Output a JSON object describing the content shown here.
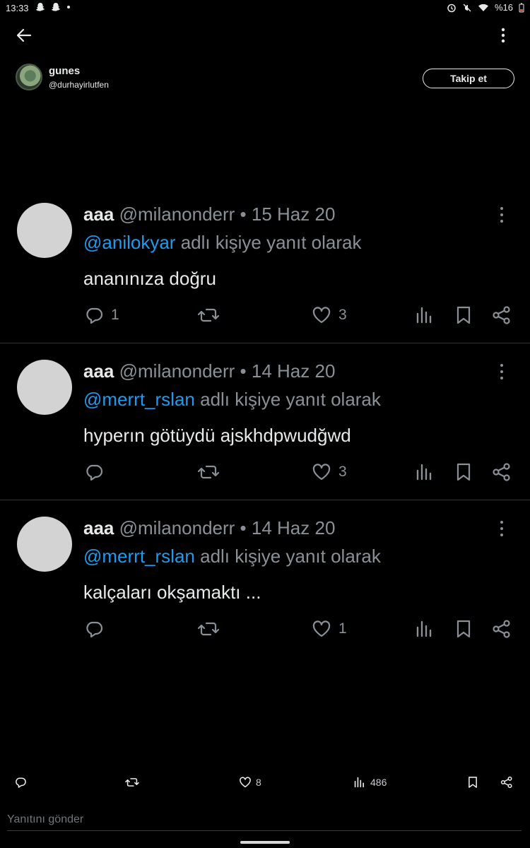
{
  "status_bar": {
    "time": "13:33",
    "battery": "%16"
  },
  "author": {
    "name": "gunes",
    "handle": "@durhayirlutfen",
    "follow_label": "Takip et"
  },
  "replies": [
    {
      "name": "aaa",
      "handle": "@milanonderr",
      "sep": "•",
      "date": "15 Haz 20",
      "mention": "@anilokyar",
      "reply_suffix": "adlı kişiye yanıt olarak",
      "text": "ananınıza doğru",
      "reply_count": "1",
      "like_count": "3"
    },
    {
      "name": "aaa",
      "handle": "@milanonderr",
      "sep": "•",
      "date": "14 Haz 20",
      "mention": "@merrt_rslan",
      "reply_suffix": "adlı kişiye yanıt olarak",
      "text": "hyperın götüydü ajskhdpwudğwd",
      "reply_count": "",
      "like_count": "3"
    },
    {
      "name": "aaa",
      "handle": "@milanonderr",
      "sep": "•",
      "date": "14 Haz 20",
      "mention": "@merrt_rslan",
      "reply_suffix": "adlı kişiye yanıt olarak",
      "text": "kalçaları okşamaktı ...",
      "reply_count": "",
      "like_count": "1"
    }
  ],
  "bottom_bar": {
    "like_count": "8",
    "view_count": "486"
  },
  "reply_box": {
    "placeholder": "Yanıtını gönder"
  },
  "colors": {
    "background": "#000000",
    "text": "#e7e9ea",
    "muted": "#8b9096",
    "mention": "#1d9bf0",
    "divider": "#2f3336",
    "avatar_placeholder": "#d3d3d3"
  }
}
